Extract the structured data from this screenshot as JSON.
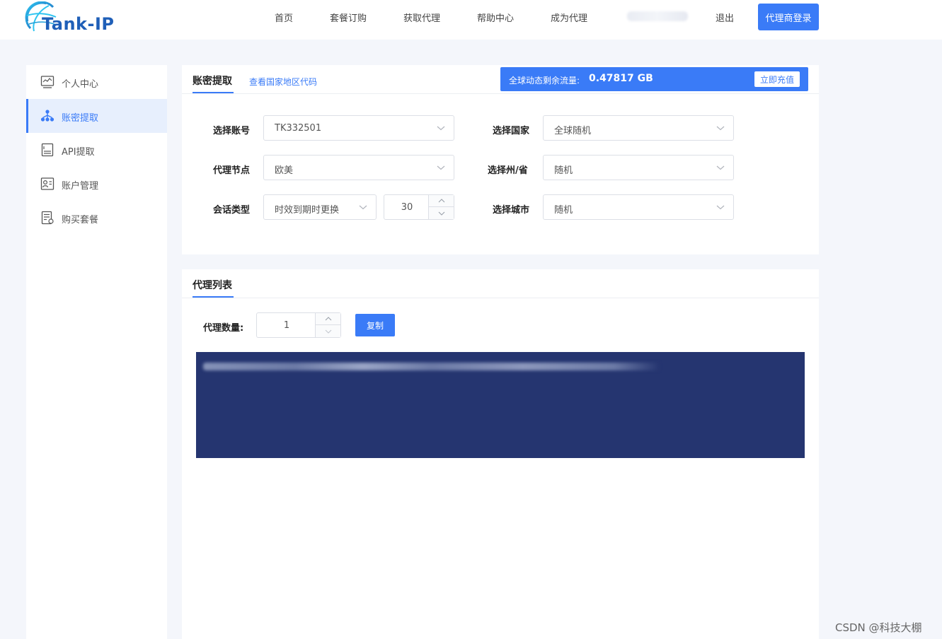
{
  "header": {
    "brand": "Tank-IP",
    "nav": [
      {
        "label": "首页"
      },
      {
        "label": "套餐订购"
      },
      {
        "label": "获取代理"
      },
      {
        "label": "帮助中心"
      },
      {
        "label": "成为代理"
      }
    ],
    "logout": "退出",
    "agent_login": "代理商登录"
  },
  "sidebar": {
    "items": [
      {
        "label": "个人中心",
        "icon": "chart-monitor-icon"
      },
      {
        "label": "账密提取",
        "icon": "network-nodes-icon",
        "active": true
      },
      {
        "label": "API提取",
        "icon": "document-icon"
      },
      {
        "label": "账户管理",
        "icon": "id-card-icon"
      },
      {
        "label": "购买套餐",
        "icon": "list-settings-icon"
      }
    ]
  },
  "extract_panel": {
    "tab": "账密提取",
    "country_code_link": "查看国家地区代码",
    "traffic": {
      "label": "全球动态剩余流量:",
      "value": "0.47817 GB",
      "recharge": "立即充值"
    },
    "fields": {
      "account": {
        "label": "选择账号",
        "value": "TK332501"
      },
      "country": {
        "label": "选择国家",
        "value": "全球随机"
      },
      "node": {
        "label": "代理节点",
        "value": "欧美"
      },
      "state": {
        "label": "选择州/省",
        "value": "随机"
      },
      "session": {
        "label": "会话类型",
        "value": "时效到期时更换",
        "duration": "30"
      },
      "city": {
        "label": "选择城市",
        "value": "随机"
      }
    }
  },
  "proxy_list_panel": {
    "tab": "代理列表",
    "quantity_label": "代理数量:",
    "quantity": "1",
    "copy": "复制"
  },
  "watermark": "CSDN @科技大棚",
  "colors": {
    "accent": "#3a7bf7",
    "output_bg": "#253570",
    "brand": "#1f5fb8"
  }
}
